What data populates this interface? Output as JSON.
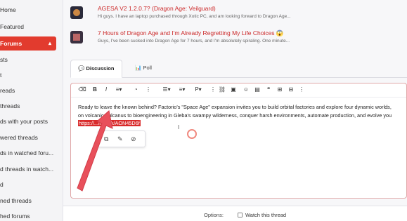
{
  "sidebar": {
    "items": [
      {
        "label": "Home"
      },
      {
        "label": "Featured"
      },
      {
        "label": "Forums"
      },
      {
        "label": "sts"
      },
      {
        "label": "t"
      },
      {
        "label": "reads"
      },
      {
        "label": "threads"
      },
      {
        "label": "ds with your posts"
      },
      {
        "label": "wered threads"
      },
      {
        "label": "ds in watched foru..."
      },
      {
        "label": "d threads in watch..."
      },
      {
        "label": "d"
      },
      {
        "label": "ned threads"
      },
      {
        "label": "hed forums"
      }
    ]
  },
  "threads": [
    {
      "title": "AGESA V2 1.2.0.7? (Dragon Age: Veilguard)",
      "snippet": "Hi guys. I have an laptop purchased through Xotic PC, and am looking forward to Dragon Age..."
    },
    {
      "title": "7 Hours of Dragon Age and I'm Already Regretting My Life Choices 😱",
      "snippet": "Guys, I've been sucked into Dragon Age for 7 hours, and I'm absolutely spiraling. One minute..."
    }
  ],
  "tabs": {
    "discussion": "Discussion",
    "poll": "Poll"
  },
  "editor": {
    "line1": "Ready to leave the known behind? Factorio's \"Space Age\" expansion invites you to build orbital factories and explore four dynamic worlds,",
    "line2": "on volcanic Vulcanus to bioengineering in Gleba's swampy wilderness, conquer harsh environments, automate production, and evolve you",
    "link": "https://...me.ink/AON45D6f"
  },
  "options": {
    "label": "Options:",
    "watch": "Watch this thread"
  },
  "colors": {
    "accent": "#e23b2e",
    "link": "#cc2a2a"
  }
}
